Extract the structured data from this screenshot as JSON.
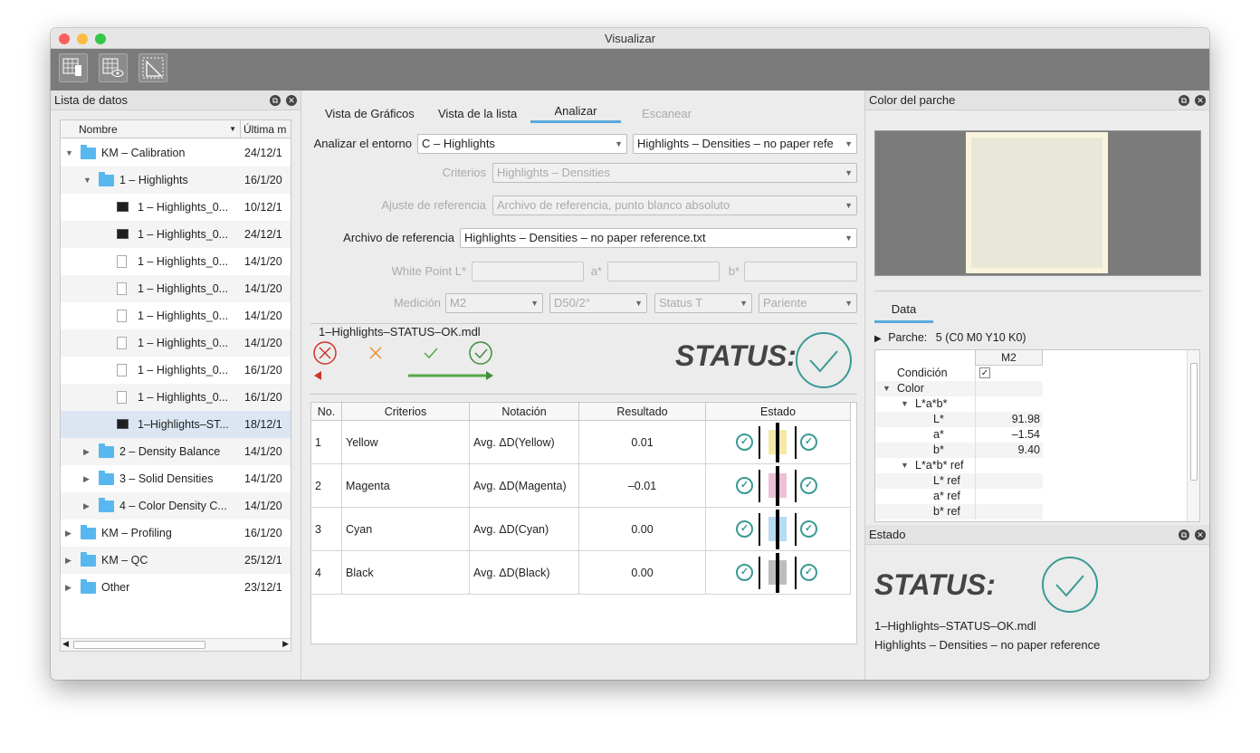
{
  "window": {
    "title": "Visualizar"
  },
  "left_panel": {
    "title": "Lista de datos",
    "col_name": "Nombre",
    "col_date": "Última m",
    "rows": [
      {
        "name": "KM – Calibration",
        "date": "24/12/1"
      },
      {
        "name": "1 – Highlights",
        "date": "16/1/20"
      },
      {
        "name": "1 – Highlights_0...",
        "date": "10/12/1"
      },
      {
        "name": "1 – Highlights_0...",
        "date": "24/12/1"
      },
      {
        "name": "1 – Highlights_0...",
        "date": "14/1/20"
      },
      {
        "name": "1 – Highlights_0...",
        "date": "14/1/20"
      },
      {
        "name": "1 – Highlights_0...",
        "date": "14/1/20"
      },
      {
        "name": "1 – Highlights_0...",
        "date": "14/1/20"
      },
      {
        "name": "1 – Highlights_0...",
        "date": "16/1/20"
      },
      {
        "name": "1 – Highlights_0...",
        "date": "16/1/20"
      },
      {
        "name": "1–Highlights–ST...",
        "date": "18/12/1"
      },
      {
        "name": "2 – Density Balance",
        "date": "14/1/20"
      },
      {
        "name": "3 – Solid Densities",
        "date": "14/1/20"
      },
      {
        "name": "4 – Color Density C...",
        "date": "14/1/20"
      },
      {
        "name": "KM – Profiling",
        "date": "16/1/20"
      },
      {
        "name": "KM – QC",
        "date": "25/12/1"
      },
      {
        "name": "Other",
        "date": "23/12/1"
      }
    ]
  },
  "center": {
    "tabs": [
      "Vista de Gráficos",
      "Vista de la lista",
      "Analizar",
      "Escanear"
    ],
    "labels": {
      "env": "Analizar el entorno",
      "criteria": "Criterios",
      "ref_adjust": "Ajuste de referencia",
      "ref_file": "Archivo de referencia",
      "white_point": "White Point  L*",
      "a": "a*",
      "b": "b*",
      "measurement": "Medición"
    },
    "env_value": "C – Highlights",
    "env_value2": "Highlights – Densities – no paper refe",
    "criteria_value": "Highlights – Densities",
    "ref_adjust_value": "Archivo de referencia, punto blanco absoluto",
    "ref_file_value": "Highlights – Densities – no paper reference.txt",
    "measurement": [
      "M2",
      "D50/2°",
      "Status T",
      "Pariente"
    ],
    "file_name": "1–Highlights–STATUS–OK.mdl",
    "status_label": "STATUS:",
    "table_headers": [
      "No.",
      "Criterios",
      "Notación",
      "Resultado",
      "Estado"
    ],
    "table_rows": [
      {
        "no": "1",
        "criterio": "Yellow",
        "notacion": "Avg. ΔD(Yellow)",
        "resultado": "0.01",
        "color": "#f5e9a6"
      },
      {
        "no": "2",
        "criterio": "Magenta",
        "notacion": "Avg. ΔD(Magenta)",
        "resultado": "–0.01",
        "color": "#eec0d8"
      },
      {
        "no": "3",
        "criterio": "Cyan",
        "notacion": "Avg. ΔD(Cyan)",
        "resultado": "0.00",
        "color": "#b4dcf2"
      },
      {
        "no": "4",
        "criterio": "Black",
        "notacion": "Avg. ΔD(Black)",
        "resultado": "0.00",
        "color": "#bdbdbd"
      }
    ]
  },
  "right": {
    "patch_title": "Color del parche",
    "data_tab": "Data",
    "parche_label": "Parche:",
    "parche_value": "5 (C0 M0 Y10 K0)",
    "col_m2": "M2",
    "props": [
      {
        "name": "Condición",
        "value": "✓"
      },
      {
        "name": "Color",
        "value": ""
      },
      {
        "name": "L*a*b*",
        "value": ""
      },
      {
        "name": "L*",
        "value": "91.98"
      },
      {
        "name": "a*",
        "value": "–1.54"
      },
      {
        "name": "b*",
        "value": "9.40"
      },
      {
        "name": "L*a*b* ref",
        "value": ""
      },
      {
        "name": "L* ref",
        "value": ""
      },
      {
        "name": "a* ref",
        "value": ""
      },
      {
        "name": "b* ref",
        "value": ""
      }
    ],
    "estado_title": "Estado",
    "status_label": "STATUS:",
    "file": "1–Highlights–STATUS–OK.mdl",
    "reference": "Highlights – Densities – no paper reference"
  },
  "colors": {
    "teal": "#3a9a94",
    "red": "#d0352b",
    "orange": "#e8912f",
    "green": "#55a846"
  }
}
